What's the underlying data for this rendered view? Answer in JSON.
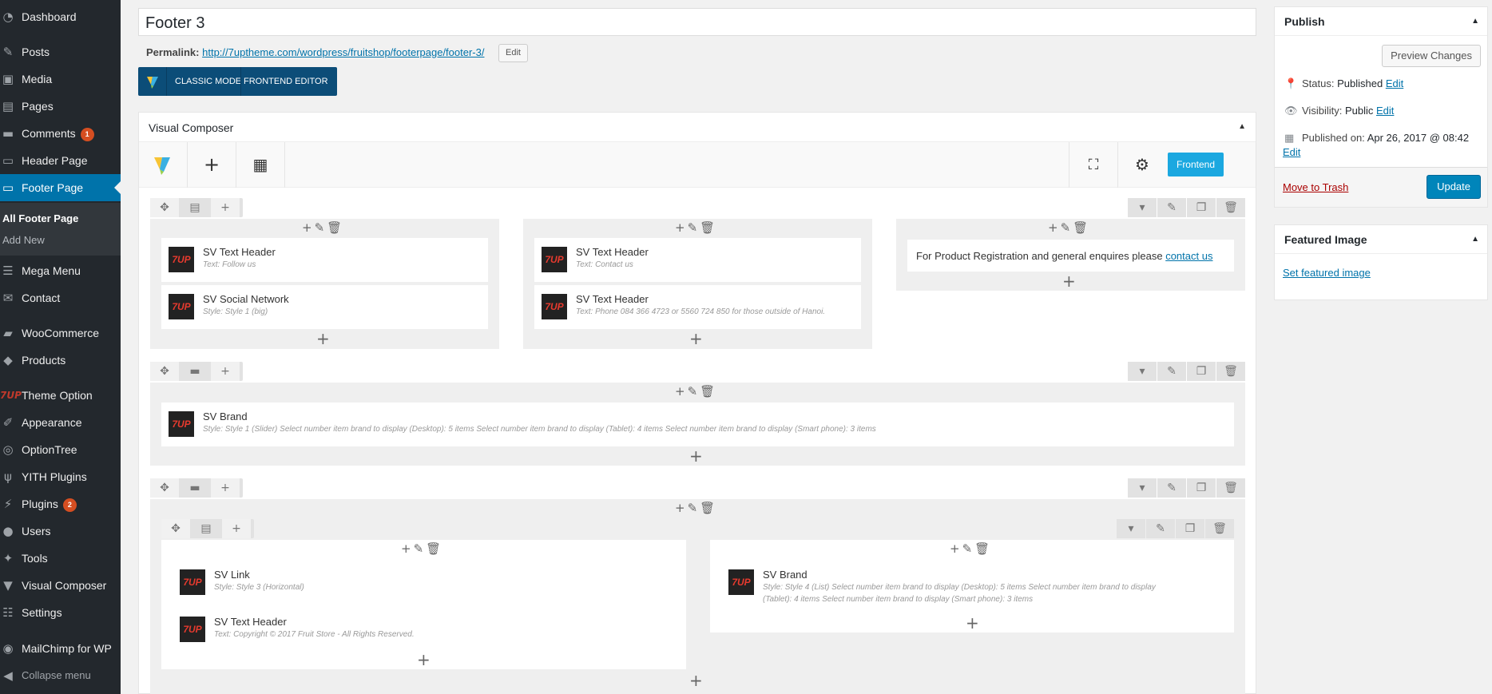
{
  "sidebar": {
    "items": [
      {
        "label": "Dashboard",
        "icon": "dashboard-icon",
        "glyph": "◔"
      },
      {
        "label": "Posts",
        "icon": "pin-icon",
        "glyph": "✎"
      },
      {
        "label": "Media",
        "icon": "media-icon",
        "glyph": "▣"
      },
      {
        "label": "Pages",
        "icon": "pages-icon",
        "glyph": "▤"
      },
      {
        "label": "Comments",
        "icon": "comments-icon",
        "glyph": "▬",
        "badge": "1"
      },
      {
        "label": "Header Page",
        "icon": "header-page-icon",
        "glyph": "▭"
      },
      {
        "label": "Footer Page",
        "icon": "footer-page-icon",
        "glyph": "▭"
      },
      {
        "label": "Mega Menu",
        "icon": "mega-menu-icon",
        "glyph": "☰"
      },
      {
        "label": "Contact",
        "icon": "envelope-icon",
        "glyph": "✉"
      },
      {
        "label": "WooCommerce",
        "icon": "woocommerce-icon",
        "glyph": "▰"
      },
      {
        "label": "Products",
        "icon": "products-icon",
        "glyph": "◆"
      },
      {
        "label": "Theme Option",
        "icon": "7up-logo-icon",
        "glyph": "7UP"
      },
      {
        "label": "Appearance",
        "icon": "brush-icon",
        "glyph": "✐"
      },
      {
        "label": "OptionTree",
        "icon": "optiontree-icon",
        "glyph": "◎"
      },
      {
        "label": "YITH Plugins",
        "icon": "yith-icon",
        "glyph": "ψ"
      },
      {
        "label": "Plugins",
        "icon": "plug-icon",
        "glyph": "⚡",
        "badge": "2"
      },
      {
        "label": "Users",
        "icon": "users-icon",
        "glyph": "●"
      },
      {
        "label": "Tools",
        "icon": "wrench-icon",
        "glyph": "✦"
      },
      {
        "label": "Visual Composer",
        "icon": "visual-composer-icon",
        "glyph": "▼"
      },
      {
        "label": "Settings",
        "icon": "settings-icon",
        "glyph": "☷"
      },
      {
        "label": "MailChimp for WP",
        "icon": "mailchimp-icon",
        "glyph": "◉"
      },
      {
        "label": "Collapse menu",
        "icon": "collapse-icon",
        "glyph": "◀"
      }
    ],
    "submenu": [
      "All Footer Page",
      "Add New"
    ]
  },
  "post": {
    "title": "Footer 3",
    "permalink_label": "Permalink:",
    "permalink_url": "http://7uptheme.com/wordpress/fruitshop/footerpage/footer-3/",
    "permalink_edit": "Edit"
  },
  "mode_bar": {
    "classic": "CLASSIC MODE",
    "frontend": "FRONTEND EDITOR"
  },
  "vc": {
    "title": "Visual Composer",
    "frontend_button": "Frontend",
    "row1": {
      "col1": [
        {
          "name": "SV Text Header",
          "desc": "Text: Follow us"
        },
        {
          "name": "SV Social Network",
          "desc": "Style: Style 1 (big)"
        }
      ],
      "col2": [
        {
          "name": "SV Text Header",
          "desc": "Text: Contact us"
        },
        {
          "name": "SV Text Header",
          "desc": "Text: Phone 084 366 4723 or 5560 724 850 for those outside of Hanoi."
        }
      ],
      "col3_text": "For Product Registration and general enquires please",
      "col3_link": "contact us"
    },
    "row2": {
      "name": "SV Brand",
      "desc": "Style: Style 1 (Slider)  Select number item brand to display (Desktop): 5 items  Select number item brand to display (Tablet): 4 items  Select number item brand to display (Smart phone): 3 items"
    },
    "row3": {
      "left": [
        {
          "name": "SV Link",
          "desc": "Style: Style 3 (Horizontal)"
        },
        {
          "name": "SV Text Header",
          "desc": "Text: Copyright © 2017 Fruit Store - All Rights Reserved."
        }
      ],
      "right_name": "SV Brand",
      "right_desc1": "Style: Style 4 (List)  Select number item brand to display (Desktop): 5 items  Select number item brand to display",
      "right_desc2": "(Tablet): 4 items  Select number item brand to display (Smart phone): 3 items"
    },
    "element_icon_text": "7UP"
  },
  "publish": {
    "title": "Publish",
    "preview": "Preview Changes",
    "status_label": "Status:",
    "status_value": "Published",
    "visibility_label": "Visibility:",
    "visibility_value": "Public",
    "published_label": "Published on:",
    "published_value": "Apr 26, 2017 @ 08:42",
    "edit": "Edit",
    "trash": "Move to Trash",
    "update": "Update"
  },
  "featured": {
    "title": "Featured Image",
    "link": "Set featured image"
  }
}
